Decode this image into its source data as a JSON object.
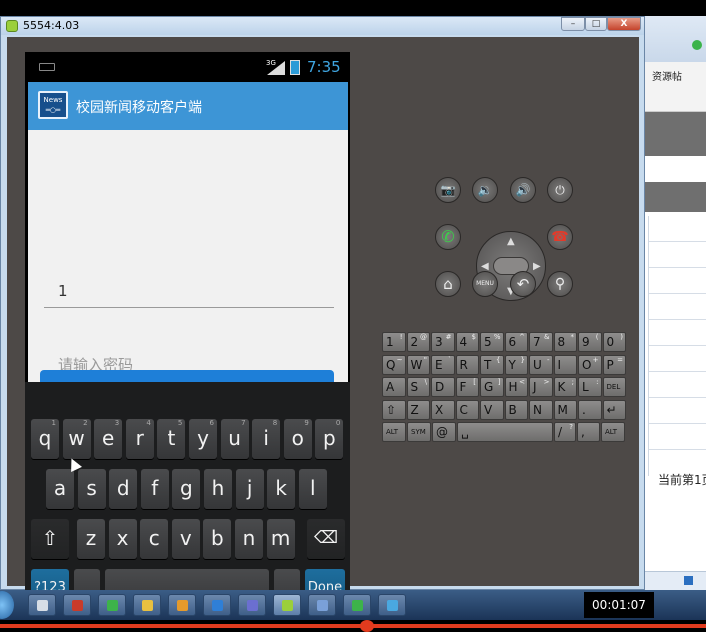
{
  "window": {
    "title": "5554:4.03",
    "minimize": "–",
    "maximize": "□",
    "close": "X"
  },
  "background_window": {
    "toolbar_label": "资源帖",
    "page_text": "当前第1页"
  },
  "status_bar": {
    "network": "3G",
    "time": "7:35"
  },
  "app": {
    "title": "校园新闻移动客户端",
    "logo_text": "News"
  },
  "login_form": {
    "username_value": "1",
    "password_placeholder": "请输入密码"
  },
  "keyboard": {
    "row1": [
      {
        "k": "q",
        "s": "1"
      },
      {
        "k": "w",
        "s": "2"
      },
      {
        "k": "e",
        "s": "3"
      },
      {
        "k": "r",
        "s": "4"
      },
      {
        "k": "t",
        "s": "5"
      },
      {
        "k": "y",
        "s": "6"
      },
      {
        "k": "u",
        "s": "7"
      },
      {
        "k": "i",
        "s": "8"
      },
      {
        "k": "o",
        "s": "9"
      },
      {
        "k": "p",
        "s": "0"
      }
    ],
    "row2": [
      "a",
      "s",
      "d",
      "f",
      "g",
      "h",
      "j",
      "k",
      "l"
    ],
    "row3": [
      "z",
      "x",
      "c",
      "v",
      "b",
      "n",
      "m"
    ],
    "symbols_label": "?123",
    "comma": ",",
    "period": ".",
    "done_label": "Done"
  },
  "emulator_keyboard": {
    "row1": [
      {
        "k": "1",
        "s": "!"
      },
      {
        "k": "2",
        "s": "@"
      },
      {
        "k": "3",
        "s": "#"
      },
      {
        "k": "4",
        "s": "$"
      },
      {
        "k": "5",
        "s": "%"
      },
      {
        "k": "6",
        "s": "^"
      },
      {
        "k": "7",
        "s": "&"
      },
      {
        "k": "8",
        "s": "*"
      },
      {
        "k": "9",
        "s": "("
      },
      {
        "k": "0",
        "s": ")"
      }
    ],
    "row2": [
      {
        "k": "Q",
        "s": "~"
      },
      {
        "k": "W",
        "s": "\""
      },
      {
        "k": "E",
        "s": "`"
      },
      {
        "k": "R",
        "s": ""
      },
      {
        "k": "T",
        "s": "{"
      },
      {
        "k": "Y",
        "s": "}"
      },
      {
        "k": "U",
        "s": "-"
      },
      {
        "k": "I",
        "s": ""
      },
      {
        "k": "O",
        "s": "+"
      },
      {
        "k": "P",
        "s": "="
      }
    ],
    "row3": [
      {
        "k": "A",
        "s": ""
      },
      {
        "k": "S",
        "s": "\\"
      },
      {
        "k": "D",
        "s": ""
      },
      {
        "k": "F",
        "s": "["
      },
      {
        "k": "G",
        "s": "]"
      },
      {
        "k": "H",
        "s": "<"
      },
      {
        "k": "J",
        "s": ">"
      },
      {
        "k": "K",
        "s": ";"
      },
      {
        "k": "L",
        "s": ":"
      },
      {
        "k": "DEL",
        "s": ""
      }
    ],
    "row4": [
      {
        "k": "⇧",
        "s": ""
      },
      {
        "k": "Z",
        "s": ""
      },
      {
        "k": "X",
        "s": ""
      },
      {
        "k": "C",
        "s": ""
      },
      {
        "k": "V",
        "s": ""
      },
      {
        "k": "B",
        "s": ""
      },
      {
        "k": "N",
        "s": ""
      },
      {
        "k": "M",
        "s": ""
      },
      {
        "k": ".",
        "s": ""
      },
      {
        "k": "↵",
        "s": ""
      }
    ],
    "row5": [
      {
        "k": "ALT",
        "s": ""
      },
      {
        "k": "SYM",
        "s": ""
      },
      {
        "k": "@",
        "s": ""
      },
      {
        "k": "␣",
        "s": ""
      },
      {
        "k": "/",
        "s": "?"
      },
      {
        "k": ",",
        "s": ""
      },
      {
        "k": "ALT",
        "s": ""
      }
    ]
  },
  "controls": {
    "camera": "📷",
    "vol_down": "🔉",
    "vol_up": "🔊",
    "power": "⏻",
    "call": "✆",
    "end_call": "☎",
    "home": "⌂",
    "menu": "MENU",
    "back": "↶",
    "search": "⚲"
  },
  "taskbar": {
    "video_time": "00:01:07"
  },
  "colors": {
    "action_bar": "#3d95d6",
    "time_text": "#3fa5e0",
    "focus_line": "#2f8ccf",
    "done_key": "#1e6e9e",
    "recording_bar": "#e23b1e"
  }
}
